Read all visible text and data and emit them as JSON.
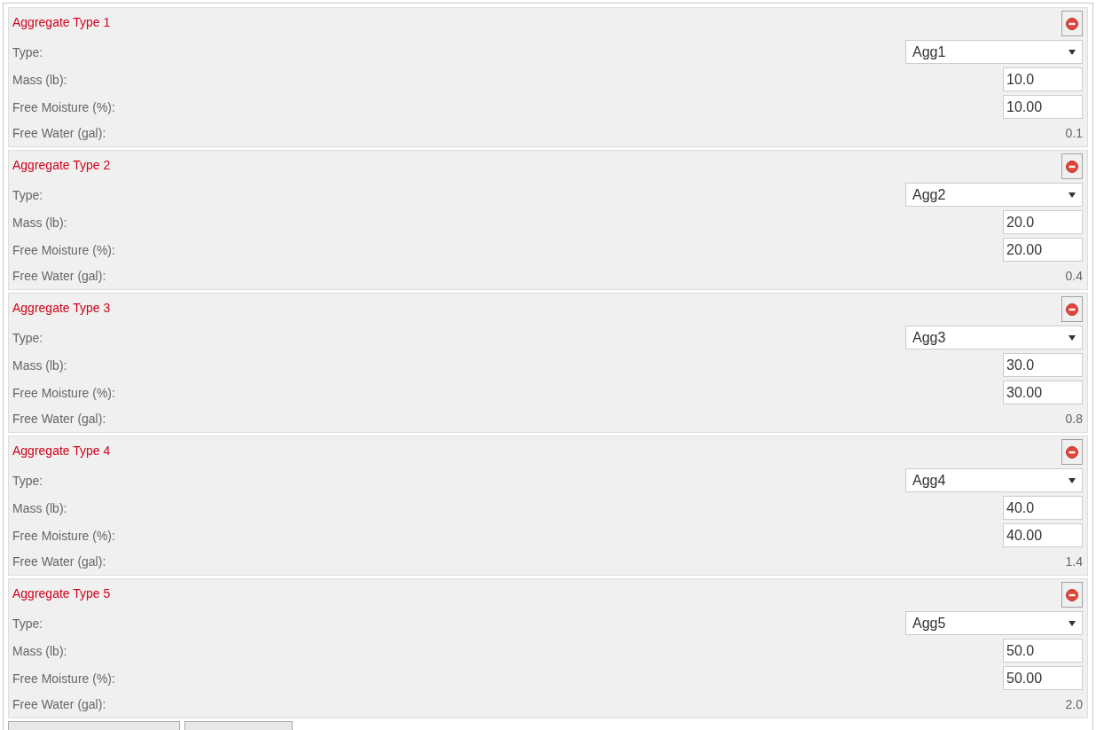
{
  "aggregates": [
    {
      "title": "Aggregate Type 1",
      "rows": [
        {
          "kind": "select",
          "label": "Type:",
          "value": "Agg1"
        },
        {
          "kind": "input",
          "label": "Mass (lb):",
          "value": "10.0"
        },
        {
          "kind": "input",
          "label": "Free Moisture (%):",
          "value": "10.00"
        },
        {
          "kind": "readout",
          "label": "Free Water (gal):",
          "value": "0.1"
        }
      ]
    },
    {
      "title": "Aggregate Type 2",
      "rows": [
        {
          "kind": "select",
          "label": "Type:",
          "value": "Agg2"
        },
        {
          "kind": "input",
          "label": "Mass (lb):",
          "value": "20.0"
        },
        {
          "kind": "input",
          "label": "Free Moisture (%):",
          "value": "20.00"
        },
        {
          "kind": "readout",
          "label": "Free Water (gal):",
          "value": "0.4"
        }
      ]
    },
    {
      "title": "Aggregate Type 3",
      "rows": [
        {
          "kind": "select",
          "label": "Type:",
          "value": "Agg3"
        },
        {
          "kind": "input",
          "label": "Mass (lb):",
          "value": "30.0"
        },
        {
          "kind": "input",
          "label": "Free Moisture (%):",
          "value": "30.00"
        },
        {
          "kind": "readout",
          "label": "Free Water (gal):",
          "value": "0.8"
        }
      ]
    },
    {
      "title": "Aggregate Type 4",
      "rows": [
        {
          "kind": "select",
          "label": "Type:",
          "value": "Agg4"
        },
        {
          "kind": "input",
          "label": "Mass (lb):",
          "value": "40.0"
        },
        {
          "kind": "input",
          "label": "Free Moisture (%):",
          "value": "40.00"
        },
        {
          "kind": "readout",
          "label": "Free Water (gal):",
          "value": "1.4"
        }
      ]
    },
    {
      "title": "Aggregate Type 5",
      "rows": [
        {
          "kind": "select",
          "label": "Type:",
          "value": "Agg5"
        },
        {
          "kind": "input",
          "label": "Mass (lb):",
          "value": "50.0"
        },
        {
          "kind": "input",
          "label": "Free Moisture (%):",
          "value": "50.00"
        },
        {
          "kind": "readout",
          "label": "Free Water (gal):",
          "value": "2.0"
        }
      ]
    }
  ]
}
